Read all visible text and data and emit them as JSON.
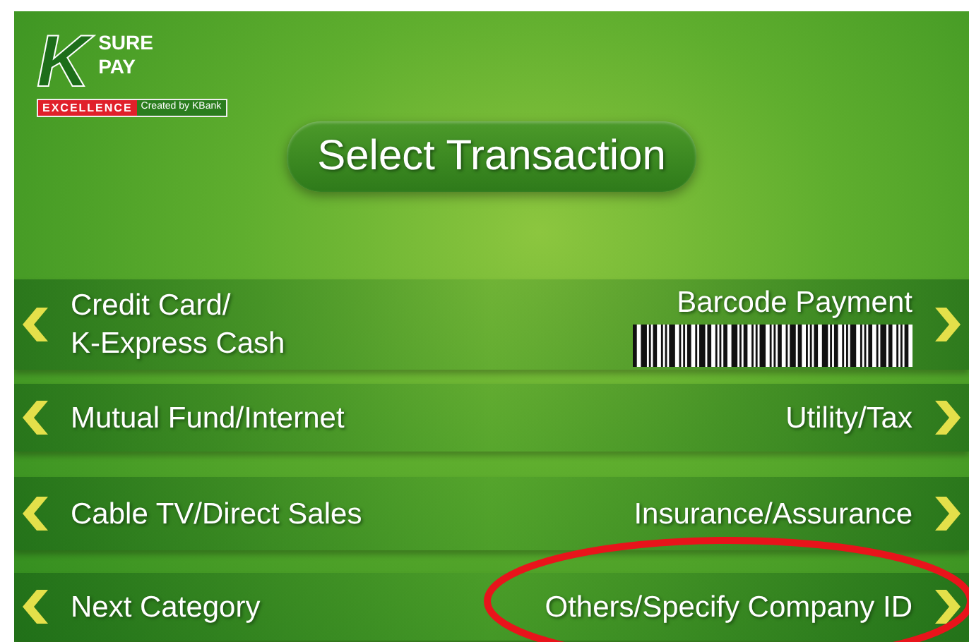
{
  "logo": {
    "letter": "K",
    "lines": [
      "SURE",
      "PAY"
    ],
    "tagline": "EXCELLENCE",
    "credit": "Created by KBank"
  },
  "title": "Select Transaction",
  "rows": [
    {
      "left": {
        "label": "Credit Card/\nK-Express Cash"
      },
      "right": {
        "label": "Barcode Payment",
        "kind": "barcode"
      }
    },
    {
      "left": {
        "label": "Mutual Fund/Internet"
      },
      "right": {
        "label": "Utility/Tax",
        "kind": "plain"
      }
    },
    {
      "left": {
        "label": "Cable TV/Direct Sales"
      },
      "right": {
        "label": "Insurance/Assurance",
        "kind": "plain"
      }
    },
    {
      "left": {
        "label": "Next Category"
      },
      "right": {
        "label": "Others/Specify Company ID",
        "kind": "plain"
      }
    }
  ],
  "annotations": [
    {
      "kind": "ellipse"
    }
  ]
}
